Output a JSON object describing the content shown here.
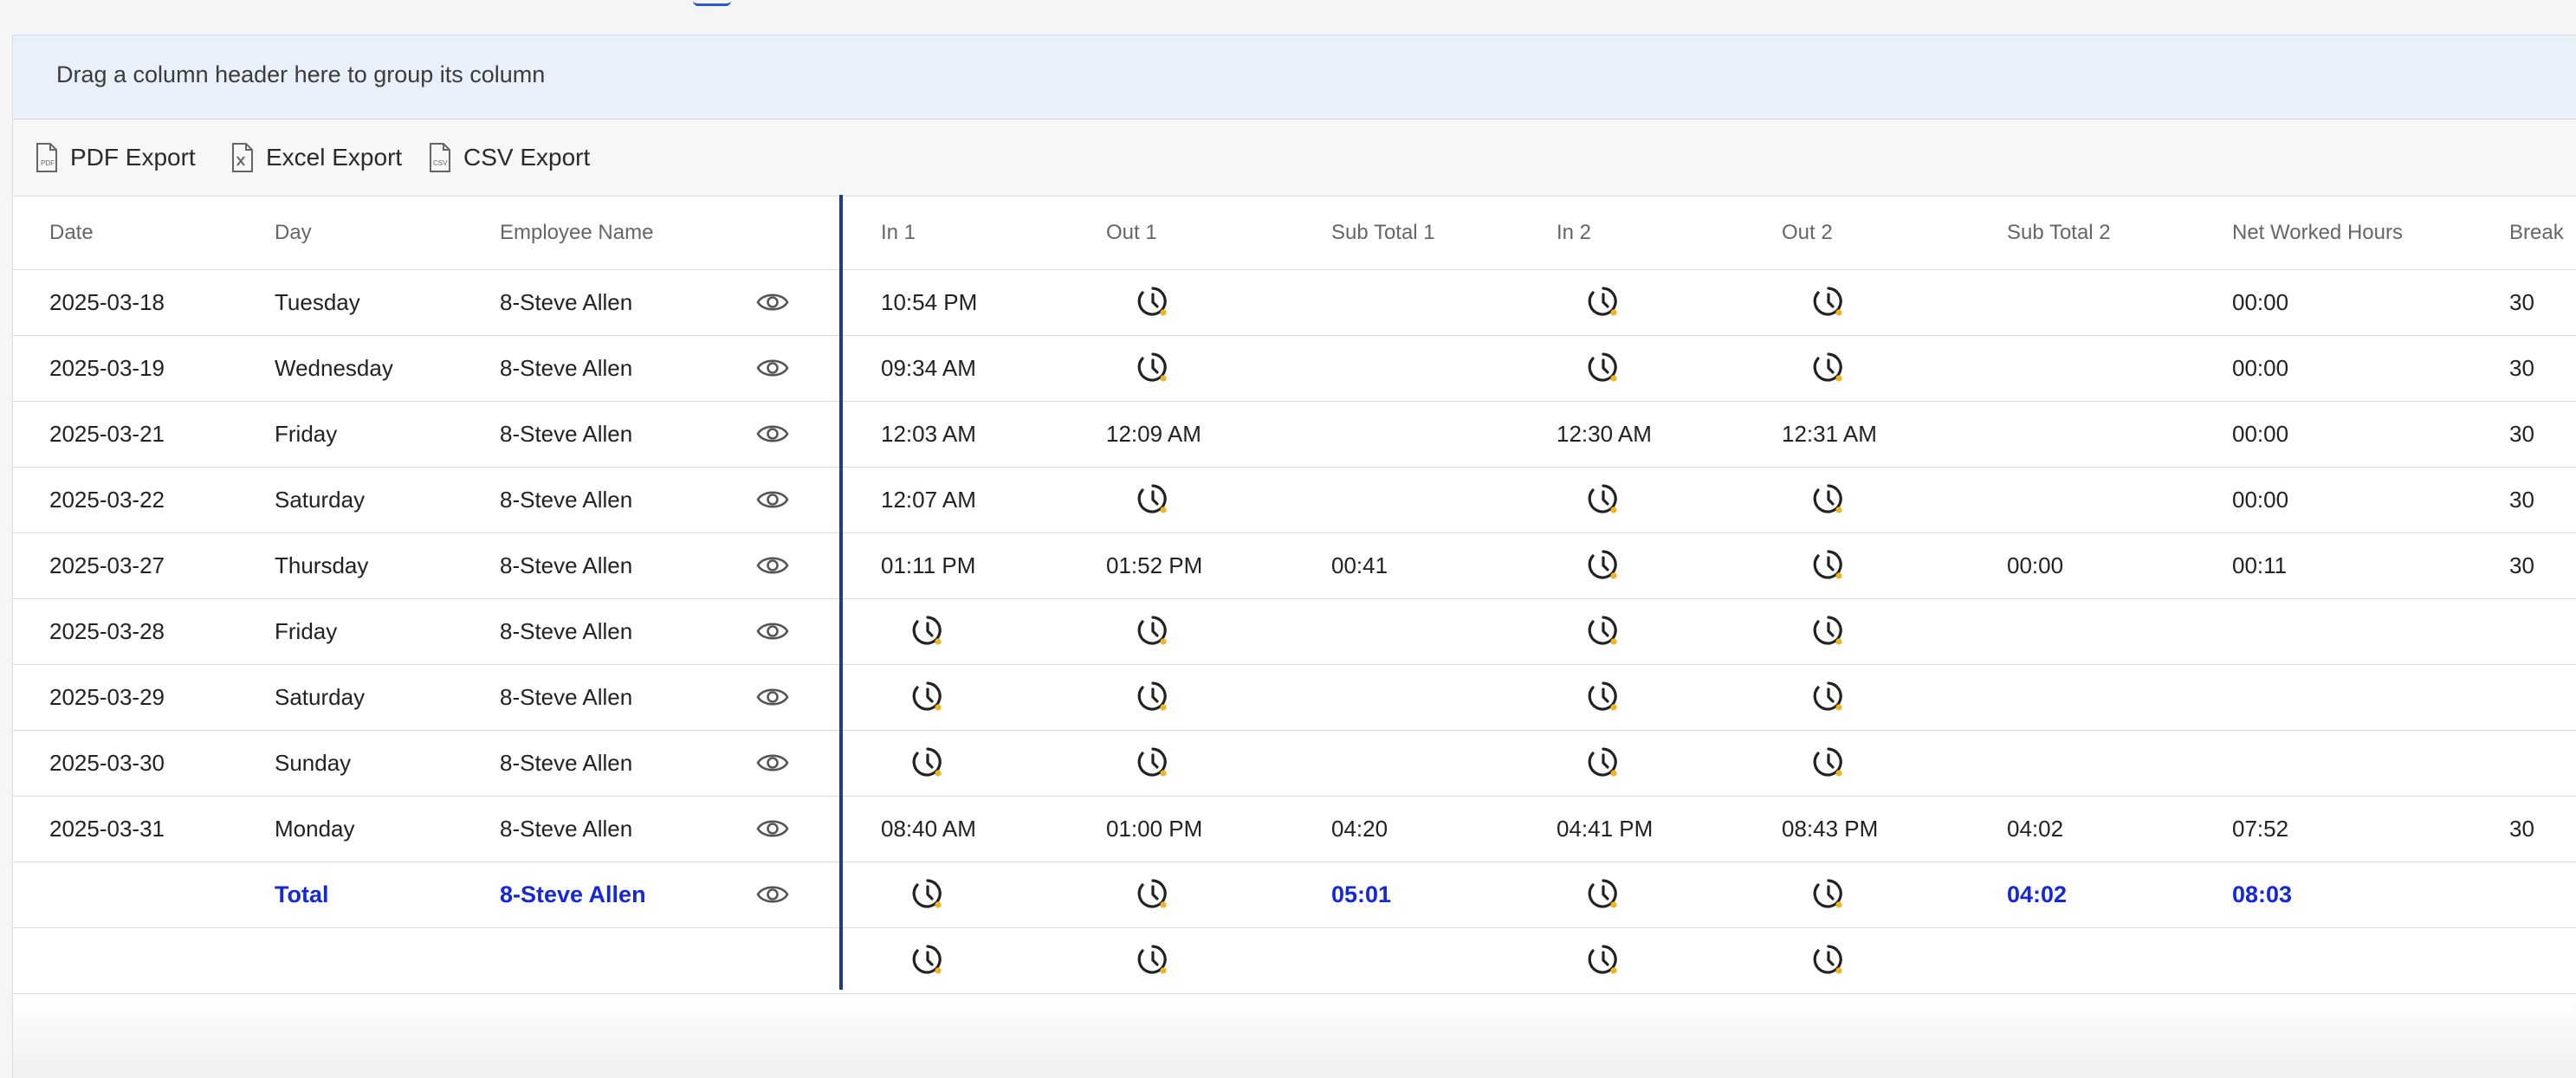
{
  "group_bar": {
    "text": "Drag a column header here to group its column"
  },
  "toolbar": {
    "pdf_label": "PDF Export",
    "excel_label": "Excel Export",
    "csv_label": "CSV Export"
  },
  "columns": [
    "Date",
    "Day",
    "Employee Name",
    "In 1",
    "Out 1",
    "Sub Total 1",
    "In 2",
    "Out 2",
    "Sub Total 2",
    "Net Worked Hours",
    "Break"
  ],
  "rows": [
    {
      "date": "2025-03-18",
      "day": "Tuesday",
      "name": "8-Steve Allen",
      "in1": "10:54 PM",
      "out1": "",
      "sub1": "",
      "in2": "",
      "out2": "",
      "sub2": "",
      "net": "00:00",
      "brk": "30"
    },
    {
      "date": "2025-03-19",
      "day": "Wednesday",
      "name": "8-Steve Allen",
      "in1": "09:34 AM",
      "out1": "",
      "sub1": "",
      "in2": "",
      "out2": "",
      "sub2": "",
      "net": "00:00",
      "brk": "30"
    },
    {
      "date": "2025-03-21",
      "day": "Friday",
      "name": "8-Steve Allen",
      "in1": "12:03 AM",
      "out1": "12:09 AM",
      "sub1": "",
      "in2": "12:30 AM",
      "out2": "12:31 AM",
      "sub2": "",
      "net": "00:00",
      "brk": "30"
    },
    {
      "date": "2025-03-22",
      "day": "Saturday",
      "name": "8-Steve Allen",
      "in1": "12:07 AM",
      "out1": "",
      "sub1": "",
      "in2": "",
      "out2": "",
      "sub2": "",
      "net": "00:00",
      "brk": "30"
    },
    {
      "date": "2025-03-27",
      "day": "Thursday",
      "name": "8-Steve Allen",
      "in1": "01:11 PM",
      "out1": "01:52 PM",
      "sub1": "00:41",
      "in2": "",
      "out2": "",
      "sub2": "00:00",
      "net": "00:11",
      "brk": "30"
    },
    {
      "date": "2025-03-28",
      "day": "Friday",
      "name": "8-Steve Allen",
      "in1": "",
      "out1": "",
      "sub1": "",
      "in2": "",
      "out2": "",
      "sub2": "",
      "net": "",
      "brk": ""
    },
    {
      "date": "2025-03-29",
      "day": "Saturday",
      "name": "8-Steve Allen",
      "in1": "",
      "out1": "",
      "sub1": "",
      "in2": "",
      "out2": "",
      "sub2": "",
      "net": "",
      "brk": ""
    },
    {
      "date": "2025-03-30",
      "day": "Sunday",
      "name": "8-Steve Allen",
      "in1": "",
      "out1": "",
      "sub1": "",
      "in2": "",
      "out2": "",
      "sub2": "",
      "net": "",
      "brk": ""
    },
    {
      "date": "2025-03-31",
      "day": "Monday",
      "name": "8-Steve Allen",
      "in1": "08:40 AM",
      "out1": "01:00 PM",
      "sub1": "04:20",
      "in2": "04:41 PM",
      "out2": "08:43 PM",
      "sub2": "04:02",
      "net": "07:52",
      "brk": "30"
    }
  ],
  "total_row": {
    "label": "Total",
    "name": "8-Steve Allen",
    "sub1": "05:01",
    "sub2": "04:02",
    "net": "08:03"
  },
  "colors": {
    "accent": "#1428d6",
    "frozen_divider": "#1f3a8a",
    "group_bar_bg": "#e8f0fc",
    "clock_dot": "#f0b323"
  },
  "icons": {
    "eye": "eye-icon",
    "clock": "clock-icon",
    "pdf": "pdf-file-icon",
    "excel": "excel-file-icon",
    "csv": "csv-file-icon"
  }
}
